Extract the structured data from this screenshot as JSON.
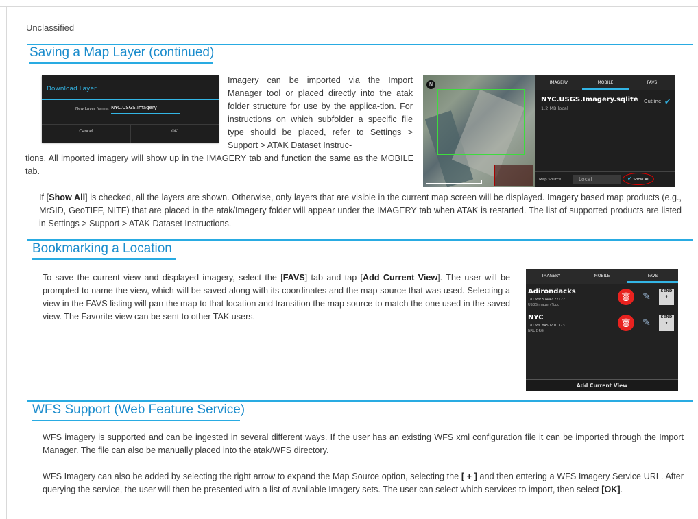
{
  "header": {
    "classification": "Unclassified"
  },
  "sections": {
    "saving": {
      "title": "Saving a Map Layer (continued)",
      "para1_wrap": "Imagery can be imported via the Import Manager tool or placed directly into the atak folder structure for use by the applica-tion. For instructions on which subfolder a specific file type should be placed, refer to Settings > Support > ATAK Dataset Instruc-",
      "para1_cont": "tions. All imported imagery will show up in the IMAGERY tab and function the same as the MOBILE tab.",
      "para2_pre": "If [",
      "para2_bold": "Show All",
      "para2_post": "] is checked, all the layers are shown. Otherwise, only layers that are visible in the current map screen will be displayed.  Imagery based map products (e.g., MrSID, GeoTIFF, NITF) that are placed in the atak/Imagery folder will appear under the IMAGERY tab when ATAK is restarted. The list of supported products are listed in Settings > Support > ATAK Dataset Instructions."
    },
    "bookmarking": {
      "title": "Bookmarking a Location",
      "p_pre": "To save the current view and displayed imagery, select the [",
      "p_bold1": "FAVS",
      "p_mid": "] tab and tap [",
      "p_bold2": "Add Current View",
      "p_post": "]. The user will be prompted to name the view, which will be saved along with its coordinates and the map source that was used. Selecting a view in the FAVS listing will pan the map to that location and transition the map source to match the one used in the saved view. The Favorite view can be sent to other TAK users."
    },
    "wfs": {
      "title": "WFS Support (Web Feature Service)",
      "para1": "WFS imagery is supported and can be ingested in several different ways. If the user has an existing WFS xml configuration file it can be imported through the Import Manager. The file can also be manually placed into the atak/WFS directory.",
      "para2_pre": "WFS Imagery can also be added by selecting the right arrow to expand the Map Source option, selecting the ",
      "para2_bold1": "[ + ]",
      "para2_mid": " and then entering a WFS Imagery Service URL. After querying the service, the user will then be presented with a list of available Imagery sets. The user can select which services to import, then select ",
      "para2_bold2": "[OK]",
      "para2_end": "."
    }
  },
  "download_dialog": {
    "title": "Download Layer",
    "field_label": "New Layer Name:",
    "field_value": "NYC.USGS.Imagery",
    "cancel_label": "Cancel",
    "ok_label": "OK"
  },
  "imagery_panel": {
    "tabs": [
      "IMAGERY",
      "MOBILE",
      "FAVS"
    ],
    "active_tab": "MOBILE",
    "layer_name": "NYC.USGS.Imagery.sqlite",
    "layer_size": "1.2 MB local",
    "outline_label": "Outline",
    "map_source_label": "Map Source",
    "map_source_value": "Local",
    "show_all_label": "Show All",
    "compass": "N",
    "accent_color": "#33b5e5"
  },
  "favs_panel": {
    "tabs": [
      "IMAGERY",
      "MOBILE",
      "FAVS"
    ],
    "active_tab": "FAVS",
    "items": [
      {
        "name": "Adirondacks",
        "coord": "18T WP 57447 27122",
        "source": "USGSImageryTopo"
      },
      {
        "name": "NYC",
        "coord": "18T WL 84502 01323",
        "source": "NRL DRG"
      }
    ],
    "send_label": "SEND",
    "add_current_view_label": "Add Current View"
  }
}
